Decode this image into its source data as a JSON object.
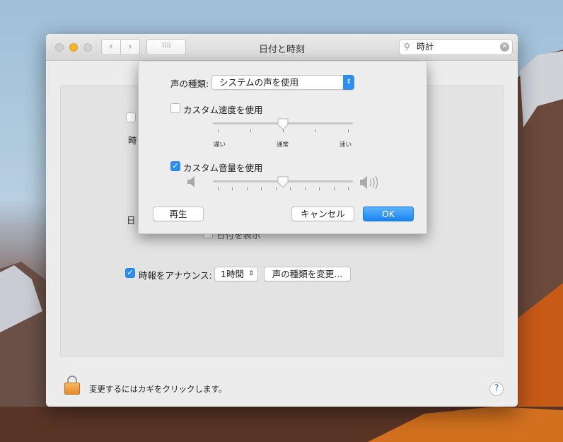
{
  "window": {
    "title": "日付と時刻",
    "search_value": "時計"
  },
  "background_panel": {
    "fragment_time": "時",
    "fragment_date": "日",
    "show_date_label": "日付を表示",
    "announce_label": "時報をアナウンス:",
    "announce_checked": true,
    "interval_value": "1時間",
    "change_voice_button": "声の種類を変更..."
  },
  "sheet": {
    "voice_label": "声の種類:",
    "voice_value": "システムの声を使用",
    "custom_rate_label": "カスタム速度を使用",
    "custom_rate_checked": false,
    "rate_value": 0.5,
    "rate_ticks": {
      "slow": "遅い",
      "normal": "通常",
      "fast": "速い"
    },
    "custom_volume_label": "カスタム音量を使用",
    "custom_volume_checked": true,
    "volume_value": 0.5,
    "play_button": "再生",
    "cancel_button": "キャンセル",
    "ok_button": "OK"
  },
  "footer": {
    "lock_text": "変更するにはカギをクリックします。",
    "help": "?"
  },
  "colors": {
    "accent": "#2d8ef0",
    "lock": "#f0a040"
  }
}
